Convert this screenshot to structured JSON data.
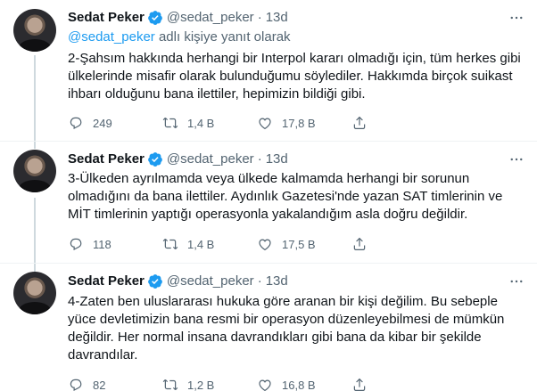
{
  "tweets": [
    {
      "name": "Sedat Peker",
      "handle": "@sedat_peker",
      "separator": "·",
      "time": "13d",
      "reply_mention": "@sedat_peker",
      "reply_suffix": " adlı kişiye yanıt olarak",
      "text": "2-Şahsım hakkında herhangi bir Interpol kararı olmadığı için, tüm herkes gibi\nülkelerinde misafir olarak bulunduğumu söylediler. Hakkımda birçok suikast\nihbarı olduğunu bana ilettiler, hepimizin bildiği gibi.",
      "replies": "249",
      "retweets": "1,4 B",
      "likes": "17,8 B"
    },
    {
      "name": "Sedat Peker",
      "handle": "@sedat_peker",
      "separator": "·",
      "time": "13d",
      "text": "3-Ülkeden ayrılmamda veya ülkede kalmamda herhangi bir sorunun\nolmadığını da bana ilettiler. Aydınlık Gazetesi'nde yazan SAT timlerinin ve\nMİT timlerinin yaptığı operasyonla yakalandığım asla doğru değildir.",
      "replies": "118",
      "retweets": "1,4 B",
      "likes": "17,5 B"
    },
    {
      "name": "Sedat Peker",
      "handle": "@sedat_peker",
      "separator": "·",
      "time": "13d",
      "text": "4-Zaten ben uluslararası hukuka göre aranan bir kişi değilim. Bu sebeple\nyüce devletimizin bana resmi bir operasyon düzenleyebilmesi de mümkün\ndeğildir. Her normal insana davrandıkları gibi bana da kibar bir şekilde\ndavrandılar.",
      "replies": "82",
      "retweets": "1,2 B",
      "likes": "16,8 B"
    }
  ],
  "colors": {
    "text": "#0f1419",
    "secondary": "#536471",
    "link": "#1d9bf0",
    "verified": "#1d9bf0",
    "thread_line": "#cfd9de",
    "divider": "#eff3f4"
  },
  "icons": [
    "verified-badge-icon",
    "more-options-icon",
    "reply-icon",
    "retweet-icon",
    "like-icon",
    "share-icon"
  ]
}
